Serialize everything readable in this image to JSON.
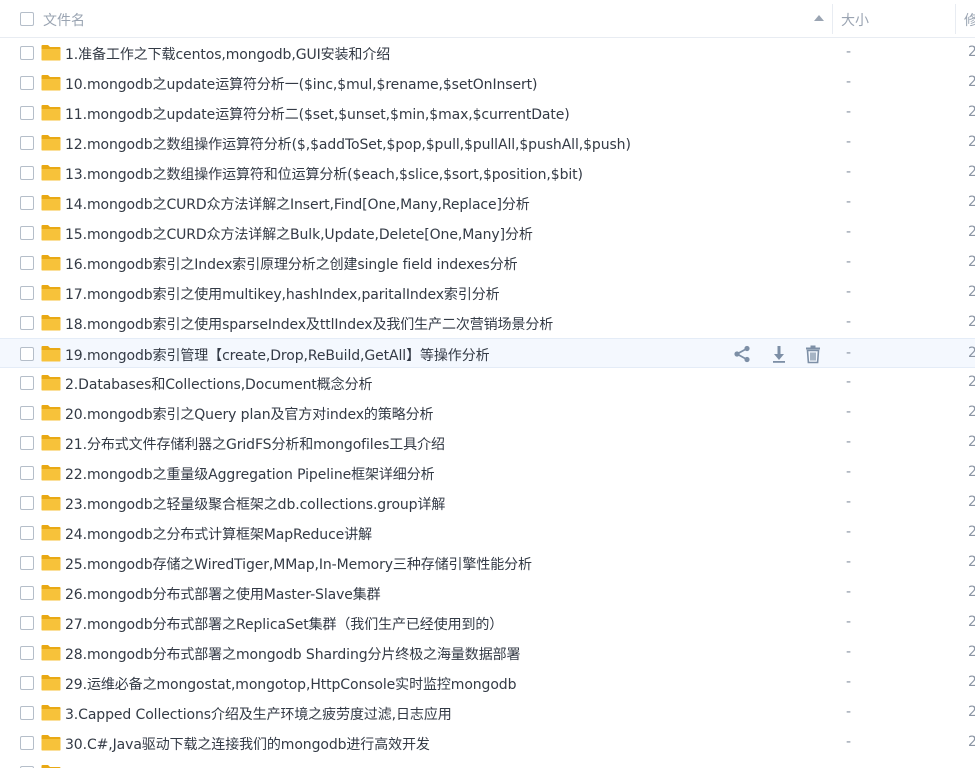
{
  "header": {
    "name_label": "文件名",
    "size_label": "大小",
    "date_label": "修"
  },
  "rows": [
    {
      "name": "1.准备工作之下载centos,mongodb,GUI安装和介绍",
      "size": "-",
      "date": "2"
    },
    {
      "name": "10.mongodb之update运算符分析一($inc,$mul,$rename,$setOnInsert)",
      "size": "-",
      "date": "2"
    },
    {
      "name": "11.mongodb之update运算符分析二($set,$unset,$min,$max,$currentDate)",
      "size": "-",
      "date": "2"
    },
    {
      "name": "12.mongodb之数组操作运算符分析($,$addToSet,$pop,$pull,$pullAll,$pushAll,$push)",
      "size": "-",
      "date": "2"
    },
    {
      "name": "13.mongodb之数组操作运算符和位运算分析($each,$slice,$sort,$position,$bit)",
      "size": "-",
      "date": "2"
    },
    {
      "name": "14.mongodb之CURD众方法详解之Insert,Find[One,Many,Replace]分析",
      "size": "-",
      "date": "2"
    },
    {
      "name": "15.mongodb之CURD众方法详解之Bulk,Update,Delete[One,Many]分析",
      "size": "-",
      "date": "2"
    },
    {
      "name": "16.mongodb索引之Index索引原理分析之创建single field indexes分析",
      "size": "-",
      "date": "2"
    },
    {
      "name": "17.mongodb索引之使用multikey,hashIndex,paritalIndex索引分析",
      "size": "-",
      "date": "2"
    },
    {
      "name": "18.mongodb索引之使用sparseIndex及ttlIndex及我们生产二次营销场景分析",
      "size": "-",
      "date": "2"
    },
    {
      "name": "19.mongodb索引管理【create,Drop,ReBuild,GetAll】等操作分析",
      "size": "-",
      "date": "2"
    },
    {
      "name": "2.Databases和Collections,Document概念分析",
      "size": "-",
      "date": "2"
    },
    {
      "name": "20.mongodb索引之Query plan及官方对index的策略分析",
      "size": "-",
      "date": "2"
    },
    {
      "name": "21.分布式文件存储利器之GridFS分析和mongofiles工具介绍",
      "size": "-",
      "date": "2"
    },
    {
      "name": "22.mongodb之重量级Aggregation Pipeline框架详细分析",
      "size": "-",
      "date": "2"
    },
    {
      "name": "23.mongodb之轻量级聚合框架之db.collections.group详解",
      "size": "-",
      "date": "2"
    },
    {
      "name": "24.mongodb之分布式计算框架MapReduce讲解",
      "size": "-",
      "date": "2"
    },
    {
      "name": "25.mongodb存储之WiredTiger,MMap,In-Memory三种存储引擎性能分析",
      "size": "-",
      "date": "2"
    },
    {
      "name": "26.mongodb分布式部署之使用Master-Slave集群",
      "size": "-",
      "date": "2"
    },
    {
      "name": "27.mongodb分布式部署之ReplicaSet集群（我们生产已经使用到的）",
      "size": "-",
      "date": "2"
    },
    {
      "name": "28.mongodb分布式部署之mongodb Sharding分片终极之海量数据部署",
      "size": "-",
      "date": "2"
    },
    {
      "name": "29.运维必备之mongostat,mongotop,HttpConsole实时监控mongodb",
      "size": "-",
      "date": "2"
    },
    {
      "name": "3.Capped Collections介绍及生产环境之疲劳度过滤,日志应用",
      "size": "-",
      "date": "2"
    },
    {
      "name": "30.C#,Java驱动下载之连接我们的mongodb进行高效开发",
      "size": "-",
      "date": "2"
    }
  ],
  "hovered_row": 10,
  "row_actions": [
    "share-icon",
    "download-icon",
    "delete-icon"
  ],
  "colors": {
    "folder": "#f7c23a",
    "folder_dark": "#e9a914",
    "hover_bg": "#f4f8fe",
    "icon": "#7d8fa6",
    "header_text": "#9aa4b2"
  }
}
